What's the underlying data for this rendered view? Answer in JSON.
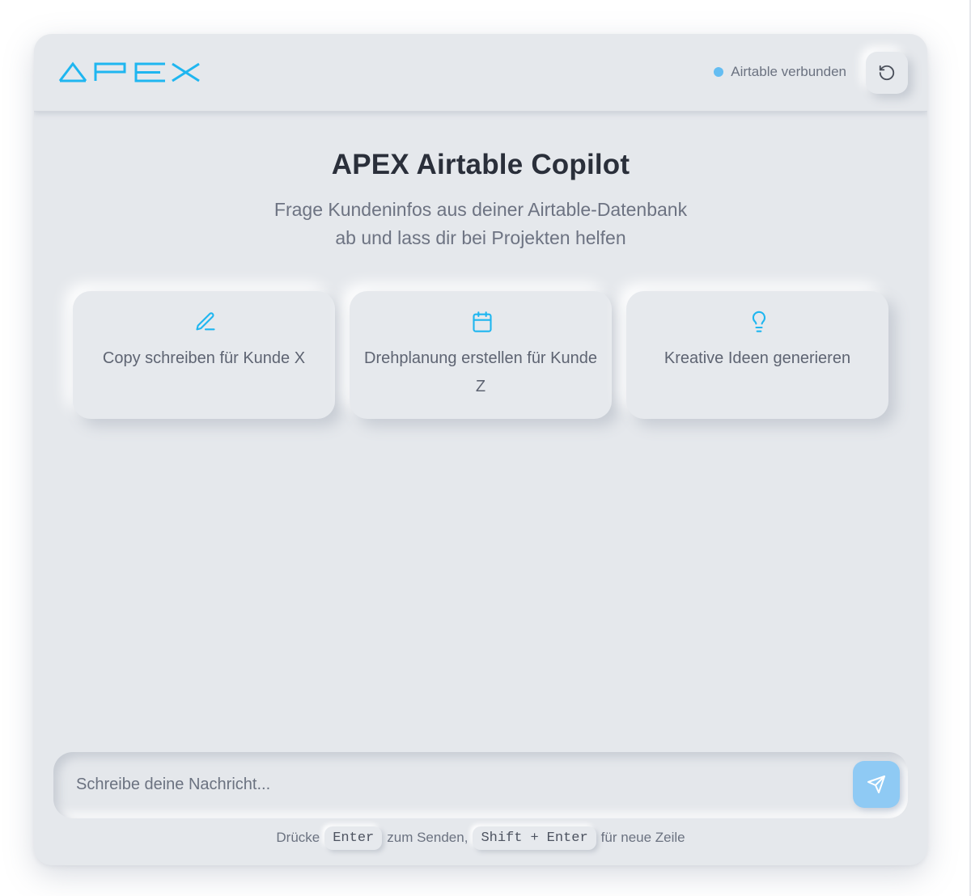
{
  "header": {
    "logo_text": "APEX",
    "status_label": "Airtable verbunden",
    "reset_icon": "refresh-ccw-icon"
  },
  "hero": {
    "title": "APEX Airtable Copilot",
    "subtitle_line1": "Frage Kundeninfos aus deiner Airtable-Datenbank",
    "subtitle_line2": "ab und lass dir bei Projekten helfen"
  },
  "suggestions": [
    {
      "label": "Copy schreiben für Kunde X",
      "icon": "pencil-icon"
    },
    {
      "label": "Drehplanung erstellen für Kunde Z",
      "icon": "calendar-icon"
    },
    {
      "label": "Kreative Ideen generieren",
      "icon": "lightbulb-icon"
    }
  ],
  "composer": {
    "placeholder": "Schreibe deine Nachricht...",
    "value": "",
    "send_icon": "send-icon"
  },
  "hint": {
    "prefix": "Drücke",
    "key_send": "Enter",
    "middle": "zum Senden,",
    "key_modifier": "Shift",
    "plus": "+",
    "key_newline": "Enter",
    "suffix": "für neue Zeile"
  },
  "colors": {
    "accent": "#1fb6f0",
    "status_dot": "#64bdf2",
    "send_button": "#8fcaf4",
    "background": "#e5e8ec",
    "title_text": "#2a2f3a"
  }
}
